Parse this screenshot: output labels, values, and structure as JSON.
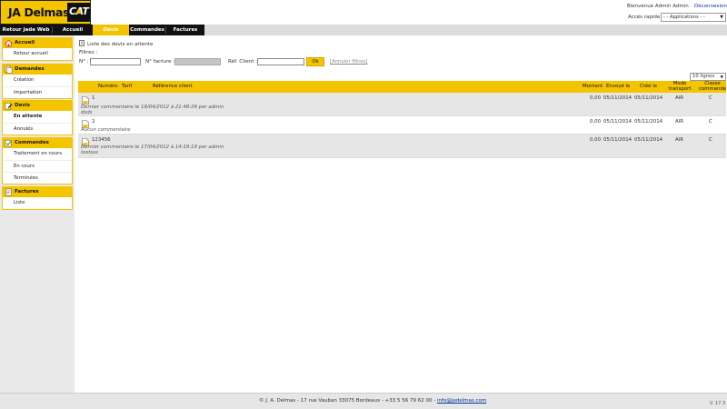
{
  "brand": {
    "name": "JA Delmas",
    "badge": "CAT"
  },
  "header": {
    "welcome": "Bienvenue Admin Admin",
    "logout": "Déconnexion",
    "quick_access_label": "Accès rapide :",
    "quick_access_value": "- - Applications - -"
  },
  "nav": {
    "items": [
      {
        "label": "Retour Jade Web"
      },
      {
        "label": "Accueil"
      },
      {
        "label": "Devis"
      },
      {
        "label": "Commandes"
      },
      {
        "label": "Factures"
      }
    ],
    "active_index": 2
  },
  "sidebar": {
    "sections": [
      {
        "title": "Accueil",
        "icon": "home-icon",
        "items": [
          "Retour accueil"
        ]
      },
      {
        "title": "Demandes",
        "icon": "documents-icon",
        "items": [
          "Création",
          "Importation"
        ]
      },
      {
        "title": "Devis",
        "icon": "edit-icon",
        "items": [
          "En attente",
          "Annulés"
        ],
        "active_item": "En attente"
      },
      {
        "title": "Commandes",
        "icon": "check-icon",
        "items": [
          "Traitement en cours",
          "En cours",
          "Terminées"
        ]
      },
      {
        "title": "Factures",
        "icon": "invoice-icon",
        "items": [
          "Liste"
        ]
      }
    ]
  },
  "main": {
    "title": "Liste des devis en attente",
    "filters_label": "Filtres :",
    "filter_no_label": "N° :",
    "filter_invoice_label": "N° facture :",
    "filter_ref_label": "Réf. Client :",
    "ok_label": "Ok",
    "cancel_filters": "[Annuler filtres]",
    "rows_per_page": "10 lignes"
  },
  "table": {
    "headers": {
      "numero": "Numéro",
      "tarif": "Tarif",
      "reference": "Référence client",
      "montant": "Montant",
      "envoye": "Envoyé le",
      "cree": "Créé le",
      "mode_l1": "Mode",
      "mode_l2": "transport",
      "classe_l1": "Classe",
      "classe_l2": "commande"
    },
    "rows": [
      {
        "numero": "1",
        "montant": "0,00",
        "envoye": "05/11/2014",
        "cree": "05/11/2014",
        "mode": "AIR",
        "classe": "C",
        "comment": "Dernier commentaire le 19/04/2012 à 21:48:26 par admin",
        "comment_text": "dsds"
      },
      {
        "numero": "2",
        "montant": "0,00",
        "envoye": "05/11/2014",
        "cree": "05/11/2014",
        "mode": "AIR",
        "classe": "C",
        "comment": "Aucun commentaire",
        "comment_text": ""
      },
      {
        "numero": "123456",
        "montant": "0,00",
        "envoye": "05/11/2014",
        "cree": "05/11/2014",
        "mode": "AIR",
        "classe": "C",
        "comment": "Dernier commentaire le 17/04/2012 à 14:19:19 par admin",
        "comment_text": "testsss"
      }
    ]
  },
  "footer": {
    "text": "© J. A. Delmas - 17 rue Vauban 33075 Bordeaux - +33 5 56 79 62 00 -",
    "email": "info@jadelmas.com",
    "version": "V. 17.3"
  },
  "colors": {
    "accent": "#f5c400",
    "dark": "#111111",
    "link": "#0033a0"
  }
}
